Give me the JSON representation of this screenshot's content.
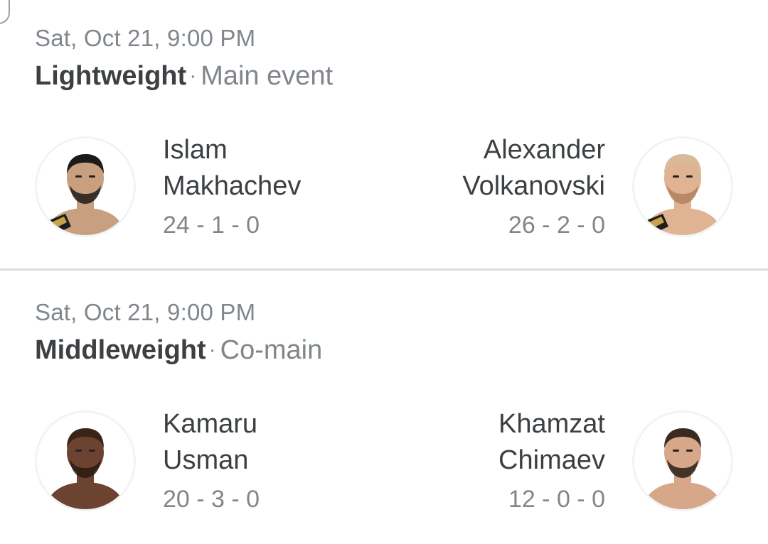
{
  "fights": [
    {
      "datetime": "Sat, Oct 21, 9:00 PM",
      "weight_class": "Lightweight",
      "separator": "·",
      "event_type": "Main event",
      "left_fighter": {
        "first_name": "Islam",
        "last_name": "Makhachev",
        "record": "24 - 1 - 0",
        "avatar_icon": "fighter-photo-icon",
        "skin": "#c9a07f",
        "hair": "#1e1a17",
        "beard": "#1e1a17",
        "belt": true
      },
      "right_fighter": {
        "first_name": "Alexander",
        "last_name": "Volkanovski",
        "record": "26 - 2 - 0",
        "avatar_icon": "fighter-photo-icon",
        "skin": "#e0b392",
        "hair": "#d9b99a",
        "beard": "#b0805f",
        "belt": true
      }
    },
    {
      "datetime": "Sat, Oct 21, 9:00 PM",
      "weight_class": "Middleweight",
      "separator": "·",
      "event_type": "Co-main",
      "left_fighter": {
        "first_name": "Kamaru",
        "last_name": "Usman",
        "record": "20 - 3 - 0",
        "avatar_icon": "fighter-photo-icon",
        "skin": "#6b4330",
        "hair": "#3a2418",
        "beard": "#2b1a12",
        "belt": false
      },
      "right_fighter": {
        "first_name": "Khamzat",
        "last_name": "Chimaev",
        "record": "12 - 0 - 0",
        "avatar_icon": "fighter-photo-icon",
        "skin": "#d6a789",
        "hair": "#3a2a22",
        "beard": "#2a1e18",
        "belt": false
      }
    }
  ],
  "colors": {
    "text_primary": "#3c4043",
    "text_secondary": "#80868b",
    "divider": "#dadce0"
  }
}
